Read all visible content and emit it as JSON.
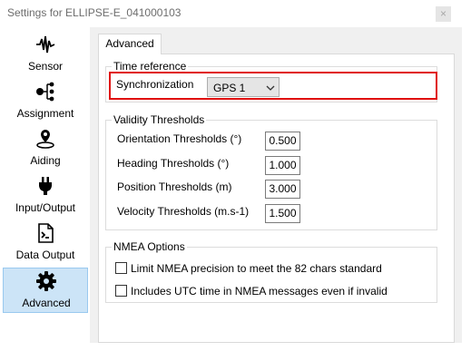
{
  "window": {
    "title": "Settings for ELLIPSE-E_041000103",
    "close_glyph": "×"
  },
  "sidebar": {
    "items": [
      {
        "label": "Sensor",
        "icon": "waveform-icon",
        "active": false
      },
      {
        "label": "Assignment",
        "icon": "hierarchy-icon",
        "active": false
      },
      {
        "label": "Aiding",
        "icon": "satellite-pin-icon",
        "active": false
      },
      {
        "label": "Input/Output",
        "icon": "plug-icon",
        "active": false
      },
      {
        "label": "Data Output",
        "icon": "document-export-icon",
        "active": true
      },
      {
        "label": "Advanced",
        "icon": "gear-icon",
        "active": true
      }
    ]
  },
  "tab": {
    "label": "Advanced"
  },
  "time_reference": {
    "legend": "Time reference",
    "sync_label": "Synchronization",
    "sync_value": "GPS 1"
  },
  "validity": {
    "legend": "Validity Thresholds",
    "rows": [
      {
        "label": "Orientation Thresholds (°)",
        "value": "0.500"
      },
      {
        "label": "Heading Thresholds (°)",
        "value": "1.000"
      },
      {
        "label": "Position Thresholds (m)",
        "value": "3.000"
      },
      {
        "label": "Velocity Thresholds (m.s-1)",
        "value": "1.500"
      }
    ]
  },
  "nmea": {
    "legend": "NMEA Options",
    "options": [
      {
        "label": "Limit NMEA precision to meet the 82 chars standard",
        "checked": false
      },
      {
        "label": "Includes UTC time in NMEA messages even if invalid",
        "checked": false
      }
    ]
  },
  "colors": {
    "highlight": "#e01010",
    "active_bg": "#cce4f7",
    "panel_bg": "#f0f0f0"
  }
}
